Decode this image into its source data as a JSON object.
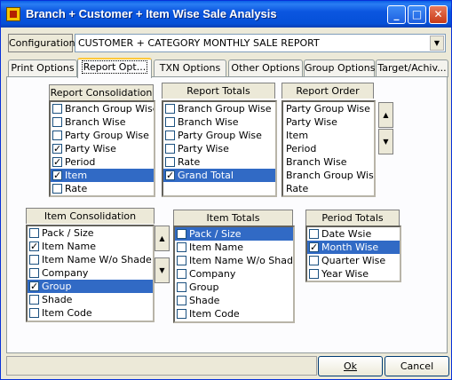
{
  "window": {
    "title": "Branch + Customer + Item Wise Sale Analysis"
  },
  "config": {
    "label": "Configuration",
    "value": "CUSTOMER + CATEGORY MONTHLY SALE REPORT"
  },
  "tabs": [
    "Print Options",
    "Report Opt...",
    "TXN Options",
    "Other Options",
    "Group Options",
    "Target/Achiv..."
  ],
  "groups": {
    "report_consolidation": {
      "title": "Report Consolidation",
      "items": [
        {
          "label": "Branch Group Wise",
          "checked": false
        },
        {
          "label": "Branch Wise",
          "checked": false
        },
        {
          "label": "Party Group Wise",
          "checked": false
        },
        {
          "label": "Party Wise",
          "checked": true
        },
        {
          "label": "Period",
          "checked": true
        },
        {
          "label": "Item",
          "checked": true,
          "selected": true
        },
        {
          "label": "Rate",
          "checked": false
        }
      ]
    },
    "report_totals": {
      "title": "Report Totals",
      "items": [
        {
          "label": "Branch Group Wise",
          "checked": false
        },
        {
          "label": "Branch Wise",
          "checked": false
        },
        {
          "label": "Party Group Wise",
          "checked": false
        },
        {
          "label": "Party Wise",
          "checked": false
        },
        {
          "label": "Rate",
          "checked": false
        },
        {
          "label": "Grand Total",
          "checked": true,
          "selected": true
        }
      ]
    },
    "report_order": {
      "title": "Report Order",
      "items": [
        "Party Group Wise",
        "Party Wise",
        "Item",
        "Period",
        "Branch Wise",
        "Branch Group Wise",
        "Rate"
      ]
    },
    "item_consolidation": {
      "title": "Item Consolidation",
      "items": [
        {
          "label": "Pack / Size",
          "checked": false
        },
        {
          "label": "Item Name",
          "checked": true
        },
        {
          "label": "Item Name W/o Shade",
          "checked": false
        },
        {
          "label": "Company",
          "checked": false
        },
        {
          "label": "Group",
          "checked": true,
          "selected": true
        },
        {
          "label": "Shade",
          "checked": false
        },
        {
          "label": "Item Code",
          "checked": false
        }
      ]
    },
    "item_totals": {
      "title": "Item Totals",
      "items": [
        {
          "label": "Pack / Size",
          "checked": false,
          "selected": true
        },
        {
          "label": "Item Name",
          "checked": false
        },
        {
          "label": "Item Name W/o Shade",
          "checked": false
        },
        {
          "label": "Company",
          "checked": false
        },
        {
          "label": "Group",
          "checked": false
        },
        {
          "label": "Shade",
          "checked": false
        },
        {
          "label": "Item Code",
          "checked": false
        }
      ]
    },
    "period_totals": {
      "title": "Period Totals",
      "items": [
        {
          "label": "Date Wsie",
          "checked": false
        },
        {
          "label": "Month Wise",
          "checked": true,
          "selected": true
        },
        {
          "label": "Quarter Wise",
          "checked": false
        },
        {
          "label": "Year Wise",
          "checked": false
        }
      ]
    }
  },
  "buttons": {
    "ok": "Ok",
    "cancel": "Cancel"
  },
  "icons": {
    "app": "app-icon",
    "minimize": "minimize-icon",
    "maximize": "maximize-icon",
    "close": "close-icon",
    "up": "arrow-up-icon",
    "down": "arrow-down-icon"
  }
}
